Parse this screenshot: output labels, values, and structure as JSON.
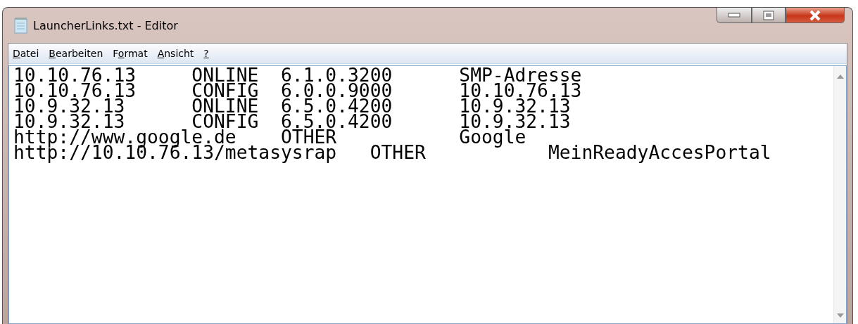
{
  "window": {
    "title": "LauncherLinks.txt - Editor"
  },
  "menu": [
    {
      "access_key": "D",
      "rest": "atei"
    },
    {
      "access_key": "B",
      "rest": "earbeiten"
    },
    {
      "lead": "F",
      "access_key": "o",
      "rest": "rmat"
    },
    {
      "access_key": "A",
      "rest": "nsicht"
    },
    {
      "access_key": "?"
    }
  ],
  "document": {
    "lines": [
      "10.10.76.13\tONLINE\t6.1.0.3200\tSMP-Adresse",
      "10.10.76.13\tCONFIG\t6.0.0.9000\t10.10.76.13",
      "10.9.32.13\tONLINE\t6.5.0.4200\t10.9.32.13",
      "10.9.32.13\tCONFIG\t6.5.0.4200\t10.9.32.13",
      "http://www.google.de\tOTHER\t\tGoogle",
      "http://10.10.76.13/metasysrap\tOTHER\t\tMeinReadyAccesPortal"
    ]
  }
}
